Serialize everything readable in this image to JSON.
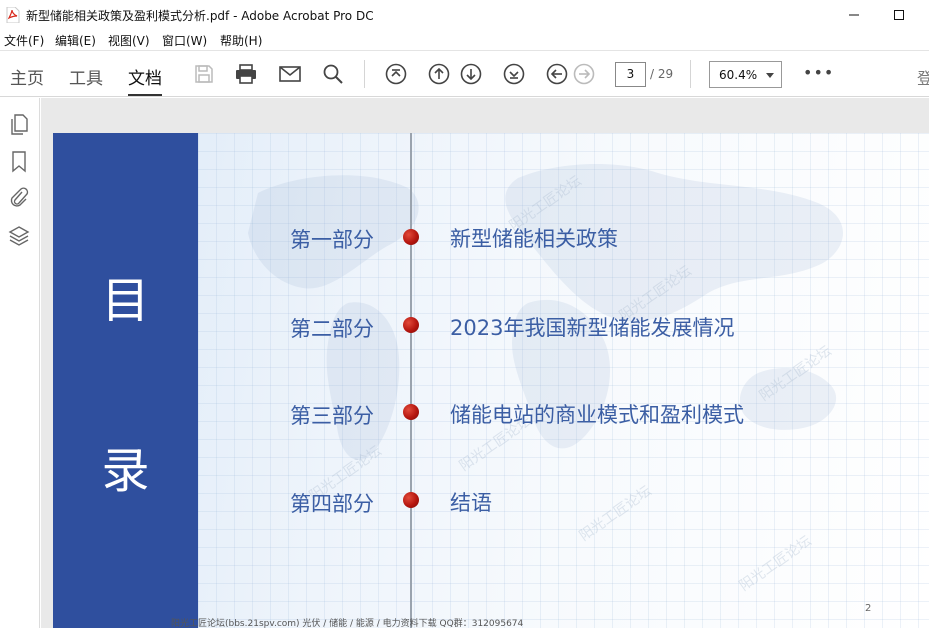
{
  "window": {
    "title": "新型储能相关政策及盈利模式分析.pdf - Adobe Acrobat Pro DC"
  },
  "menu": [
    "文件(F)",
    "编辑(E)",
    "视图(V)",
    "窗口(W)",
    "帮助(H)"
  ],
  "toolbar": {
    "tabs": [
      "主页",
      "工具",
      "文档"
    ],
    "active_tab": "文档",
    "current_page": "3",
    "total_pages": "/ 29",
    "zoom": "60.4%",
    "right_cut_text": "登"
  },
  "icons": {
    "toolbar": [
      "save-icon",
      "print-icon",
      "email-icon",
      "search-icon",
      "first-page-icon",
      "previous-page-icon",
      "next-page-icon",
      "last-page-icon",
      "back-icon",
      "forward-icon",
      "more-icon"
    ],
    "left_rail": [
      "pages-icon",
      "bookmark-icon",
      "attachment-icon",
      "layers-icon"
    ]
  },
  "slide": {
    "vertical_title": [
      "目",
      "录"
    ],
    "items": [
      {
        "part": "第一部分",
        "title": "新型储能相关政策"
      },
      {
        "part": "第二部分",
        "title": "2023年我国新型储能发展情况"
      },
      {
        "part": "第三部分",
        "title": "储能电站的商业模式和盈利模式"
      },
      {
        "part": "第四部分",
        "title": "结语"
      }
    ],
    "page_number": "2",
    "footer": "阳光工匠论坛(bbs.21spv.com)    光伏 / 储能 / 能源 / 电力资料下载    QQ群：312095674"
  },
  "colors": {
    "panel_blue": "#2f4f9e",
    "text_blue": "#3b5ea4",
    "dot_red": "#b5160f",
    "accent_red": "#d9291c"
  }
}
